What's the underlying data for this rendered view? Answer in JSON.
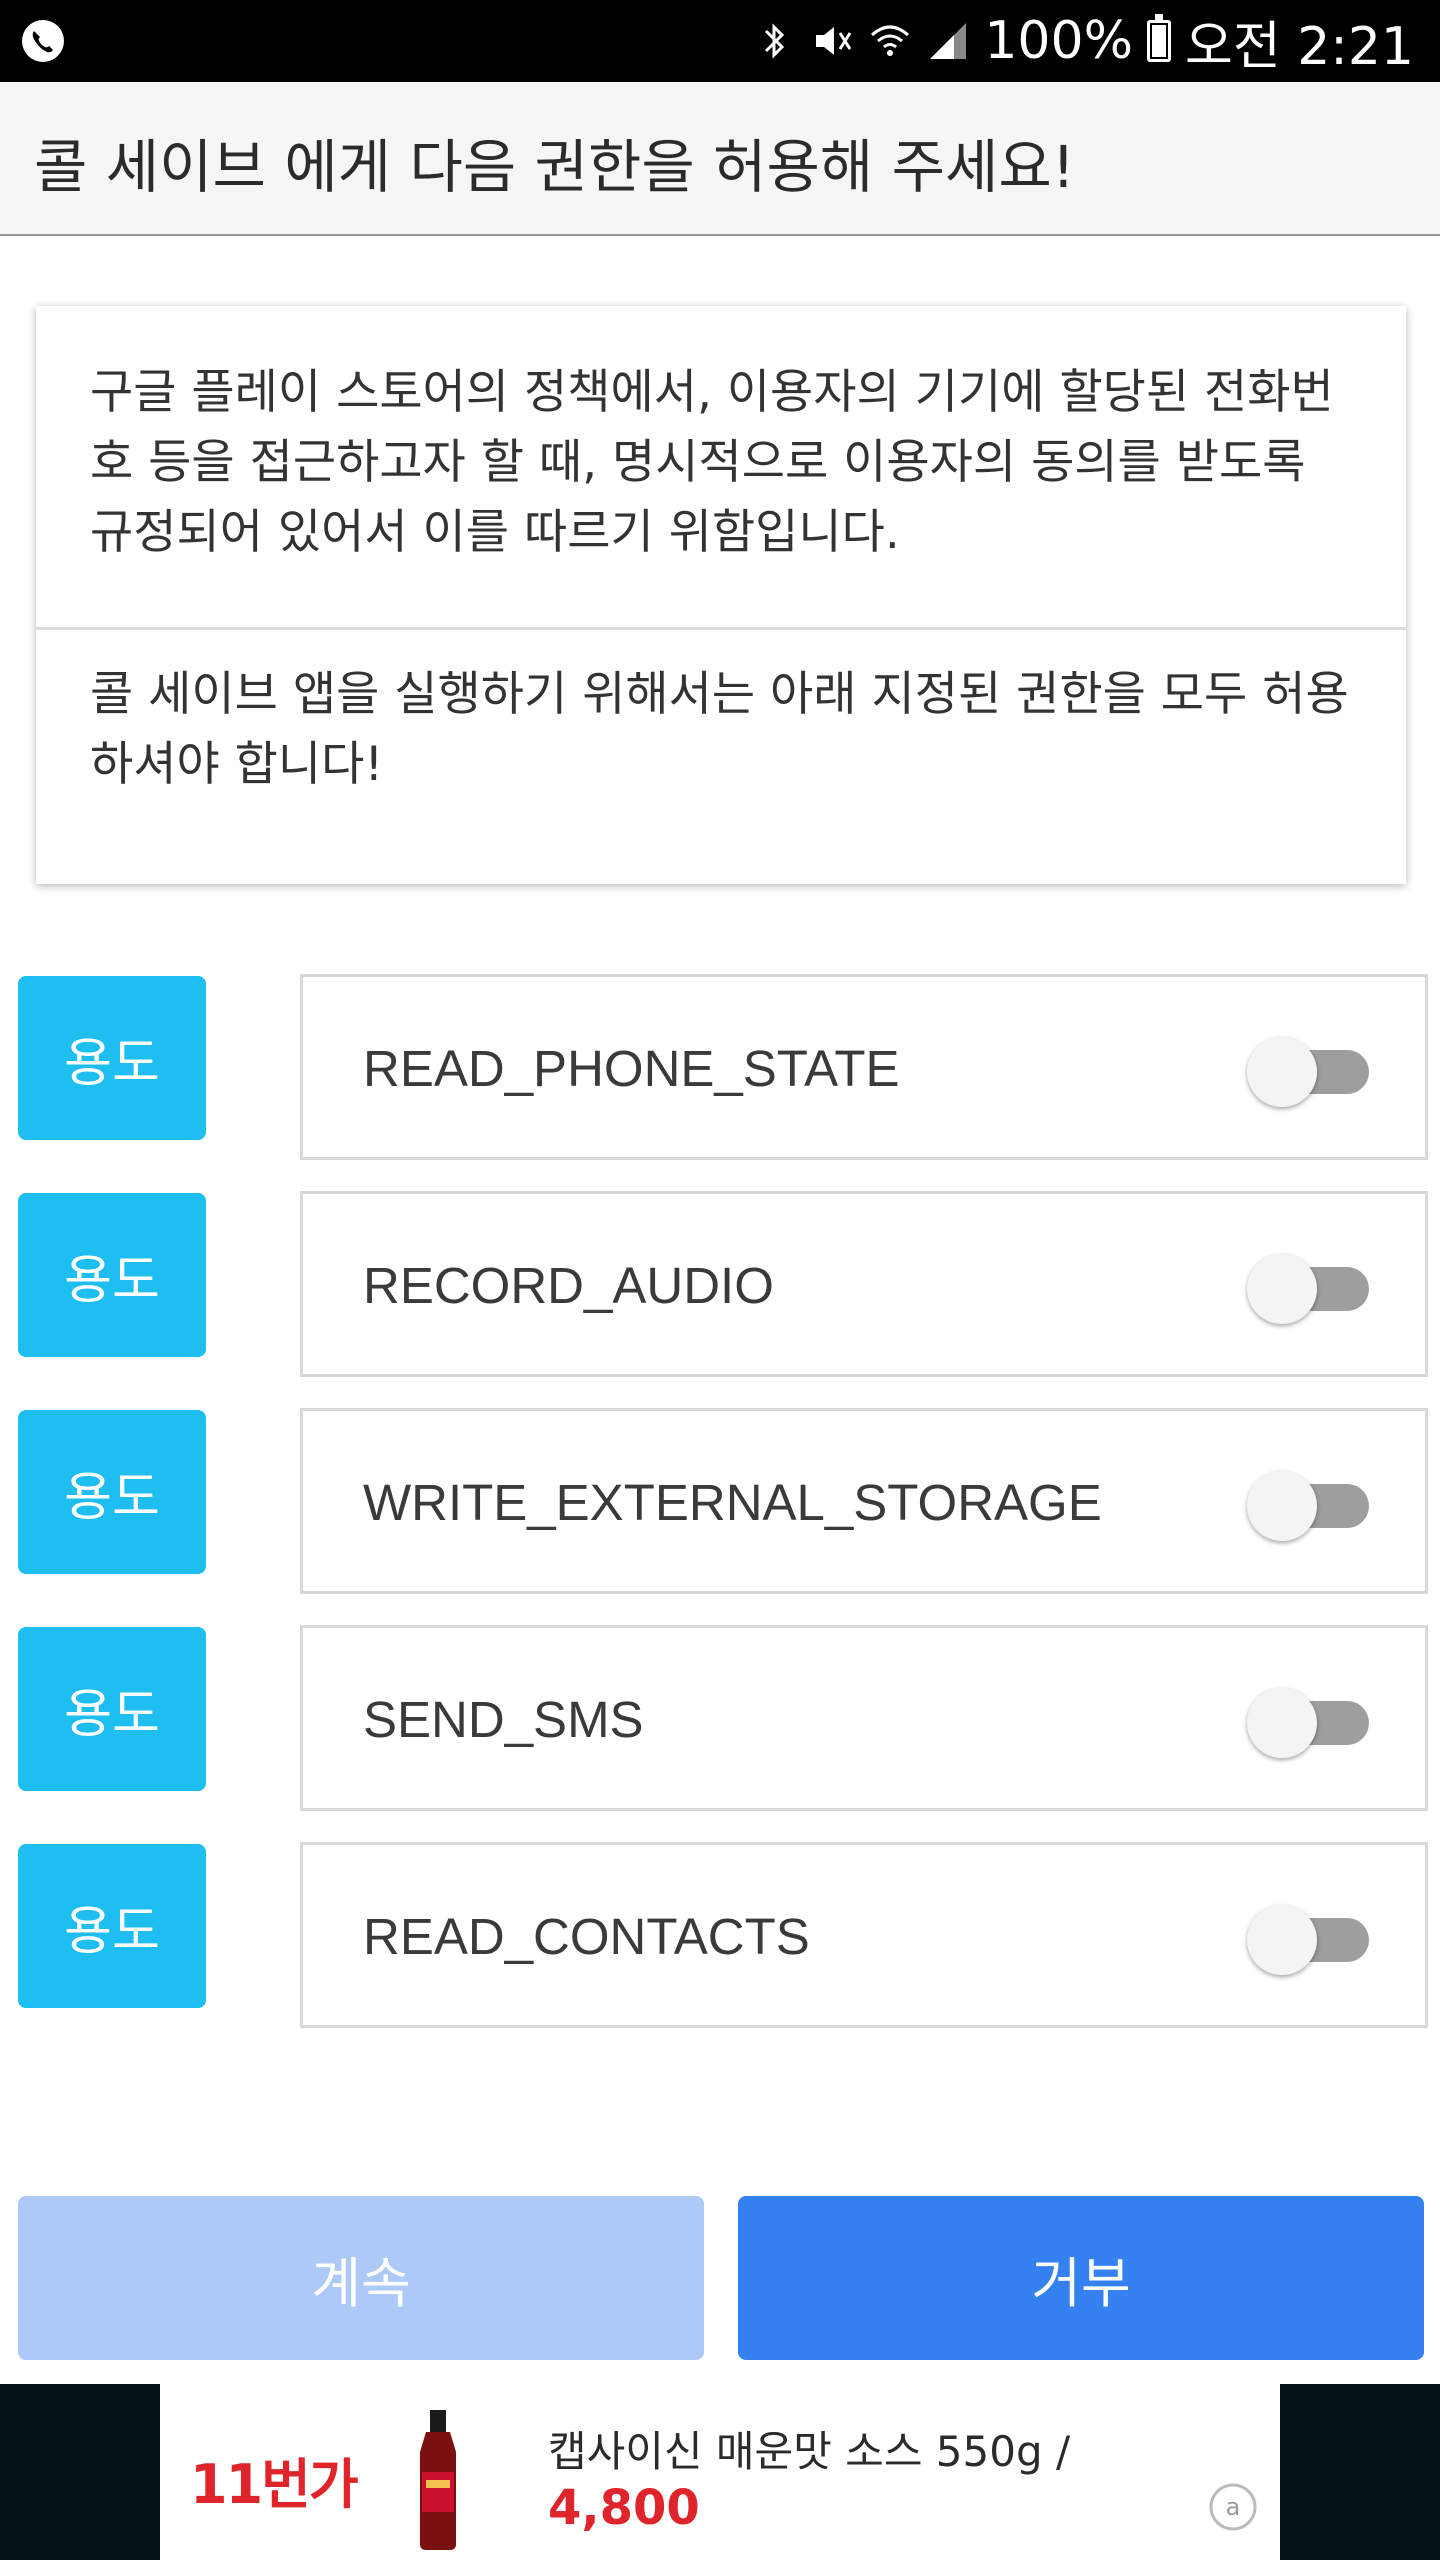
{
  "status_bar": {
    "left_icon": "phone-call-icon",
    "icons": [
      "bluetooth-icon",
      "mute-vibrate-icon",
      "wifi-icon",
      "signal-icon"
    ],
    "battery_percent": "100%",
    "time": "오전 2:21"
  },
  "header": {
    "title": "콜 세이브 에게 다음 권한을 허용해 주세요!"
  },
  "info_card": {
    "paragraph_1": "구글 플레이 스토어의 정책에서, 이용자의 기기에 할당된 전화번호 등을 접근하고자 할 때, 명시적으로 이용자의 동의를 받도록 규정되어 있어서 이를 따르기 위함입니다.",
    "paragraph_2": "콜 세이브 앱을 실행하기 위해서는 아래 지정된 권한을 모두 허용하셔야 합니다!"
  },
  "permissions": [
    {
      "purpose_label": "용도",
      "name": "READ_PHONE_STATE",
      "enabled": false
    },
    {
      "purpose_label": "용도",
      "name": "RECORD_AUDIO",
      "enabled": false
    },
    {
      "purpose_label": "용도",
      "name": "WRITE_EXTERNAL_STORAGE",
      "enabled": false
    },
    {
      "purpose_label": "용도",
      "name": "SEND_SMS",
      "enabled": false
    },
    {
      "purpose_label": "용도",
      "name": "READ_CONTACTS",
      "enabled": false
    }
  ],
  "buttons": {
    "continue_label": "계속",
    "deny_label": "거부"
  },
  "ad_banner": {
    "logo_text": "11번가",
    "product_text": "캡사이신 매운맛 소스 550g /",
    "price": "4,800"
  },
  "colors": {
    "accent": "#1ebef1",
    "deny_button": "#3681f1",
    "continue_button_disabled": "#adc9f8",
    "ad_red": "#e0242c"
  }
}
